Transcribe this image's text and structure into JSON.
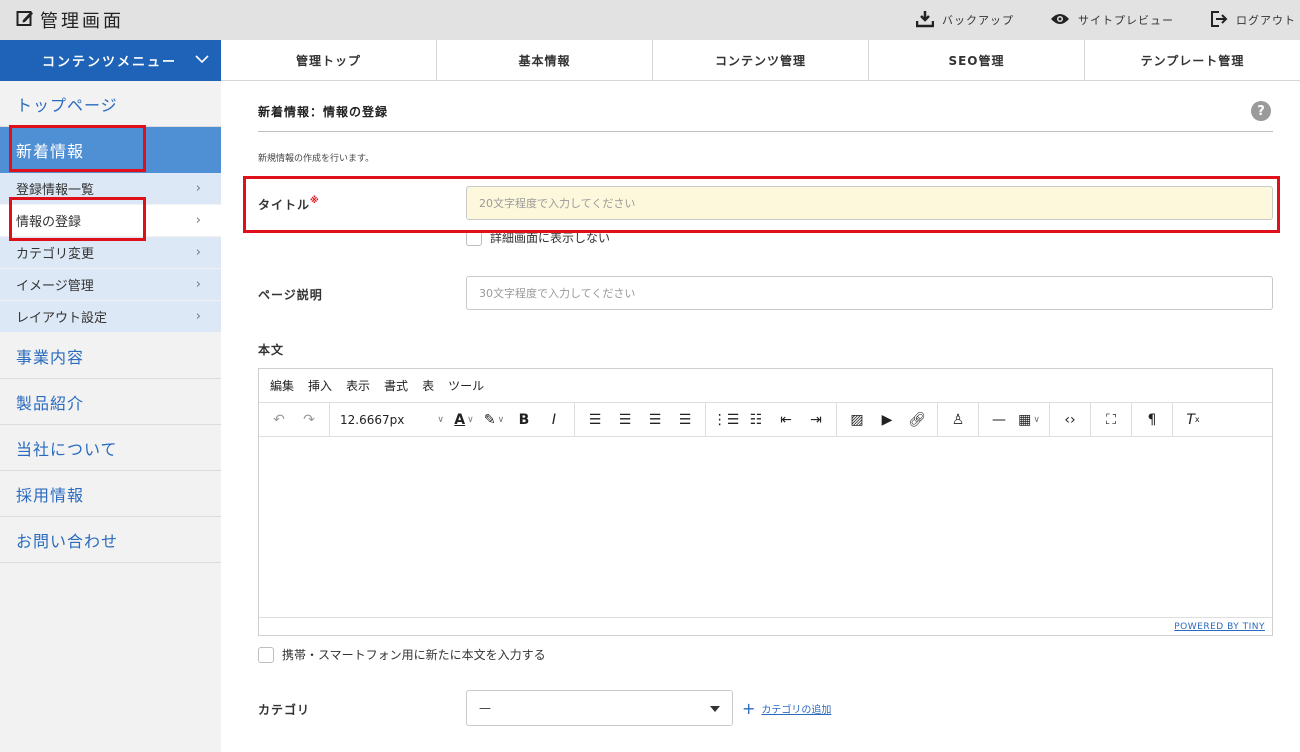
{
  "header": {
    "title": "管理画面",
    "actions": [
      {
        "label": "バックアップ",
        "icon": "download-icon"
      },
      {
        "label": "サイトプレビュー",
        "icon": "eye-icon"
      },
      {
        "label": "ログアウト",
        "icon": "logout-icon"
      }
    ]
  },
  "menu_button": {
    "label": "コンテンツメニュー"
  },
  "tabs": [
    {
      "label": "管理トップ"
    },
    {
      "label": "基本情報"
    },
    {
      "label": "コンテンツ管理"
    },
    {
      "label": "SEO管理"
    },
    {
      "label": "テンプレート管理"
    }
  ],
  "sidebar": {
    "top": "トップページ",
    "active": "新着情報",
    "sub_items": [
      {
        "label": "登録情報一覧"
      },
      {
        "label": "情報の登録"
      },
      {
        "label": "カテゴリ変更"
      },
      {
        "label": "イメージ管理"
      },
      {
        "label": "レイアウト設定"
      }
    ],
    "main_items": [
      {
        "label": "事業内容"
      },
      {
        "label": "製品紹介"
      },
      {
        "label": "当社について"
      },
      {
        "label": "採用情報"
      },
      {
        "label": "お問い合わせ"
      }
    ]
  },
  "page": {
    "heading": "新着情報：情報の登録",
    "lead": "新規情報の作成を行います。",
    "title_label": "タイトル",
    "title_required_mark": "※",
    "title_placeholder": "20文字程度で入力してください",
    "hide_detail_label": "詳細画面に表示しない",
    "desc_label": "ページ説明",
    "desc_placeholder": "30文字程度で入力してください",
    "body_label": "本文",
    "mobile_body_label": "携帯・スマートフォン用に新たに本文を入力する",
    "category_label": "カテゴリ",
    "category_value": "—",
    "add_category": "カテゴリの追加"
  },
  "editor": {
    "menus": [
      "編集",
      "挿入",
      "表示",
      "書式",
      "表",
      "ツール"
    ],
    "font_size": "12.6667px",
    "powered": "POWERED BY TINY"
  },
  "colors": {
    "accent_blue": "#1e63b8",
    "sidebar_active": "#4f8fd4",
    "highlight_red": "#e0101b",
    "title_input_bg": "#fdf8dc"
  }
}
